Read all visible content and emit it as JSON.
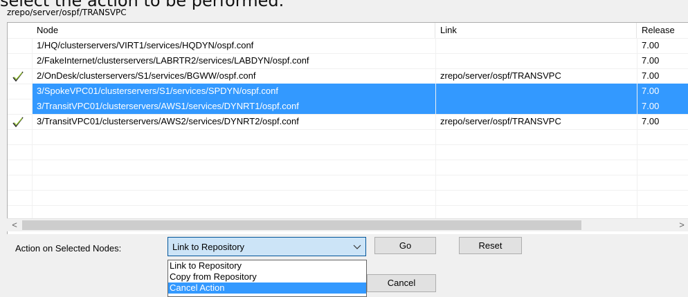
{
  "top_text": "select the action to be performed.",
  "group_label": "zrepo/server/ospf/TRANSVPC",
  "columns": {
    "node": "Node",
    "link": "Link",
    "release": "Release"
  },
  "rows": [
    {
      "node": "1/HQ/clusterservers/VIRT1/services/HQDYN/ospf.conf",
      "link": "",
      "release": "7.00"
    },
    {
      "node": "2/FakeInternet/clusterservers/LABRTR2/services/LABDYN/ospf.conf",
      "link": "",
      "release": "7.00"
    },
    {
      "node": "2/OnDesk/clusterservers/S1/services/BGWW/ospf.conf",
      "link": "zrepo/server/ospf/TRANSVPC",
      "release": "7.00",
      "checked": true
    },
    {
      "node": "3/SpokeVPC01/clusterservers/S1/services/SPDYN/ospf.conf",
      "link": "",
      "release": "7.00",
      "selected": true
    },
    {
      "node": "3/TransitVPC01/clusterservers/AWS1/services/DYNRT1/ospf.conf",
      "link": "",
      "release": "7.00",
      "selected": true
    },
    {
      "node": "3/TransitVPC01/clusterservers/AWS2/services/DYNRT2/ospf.conf",
      "link": "zrepo/server/ospf/TRANSVPC",
      "release": "7.00",
      "checked": true
    }
  ],
  "scrollbar": {
    "left_arrow": "<",
    "right_arrow": ">"
  },
  "action": {
    "label": "Action on Selected Nodes:",
    "selected_value": "Link to Repository",
    "options": [
      "Link to Repository",
      "Copy from Repository",
      "Cancel Action"
    ],
    "highlighted_option_index": 2
  },
  "buttons": {
    "go": "Go",
    "reset": "Reset",
    "cancel": "Cancel"
  },
  "icons": {
    "check": "check-icon",
    "chevron": "chevron-down-icon"
  },
  "colors": {
    "selection": "#3399ff",
    "combo_bg": "#cce4f7"
  }
}
